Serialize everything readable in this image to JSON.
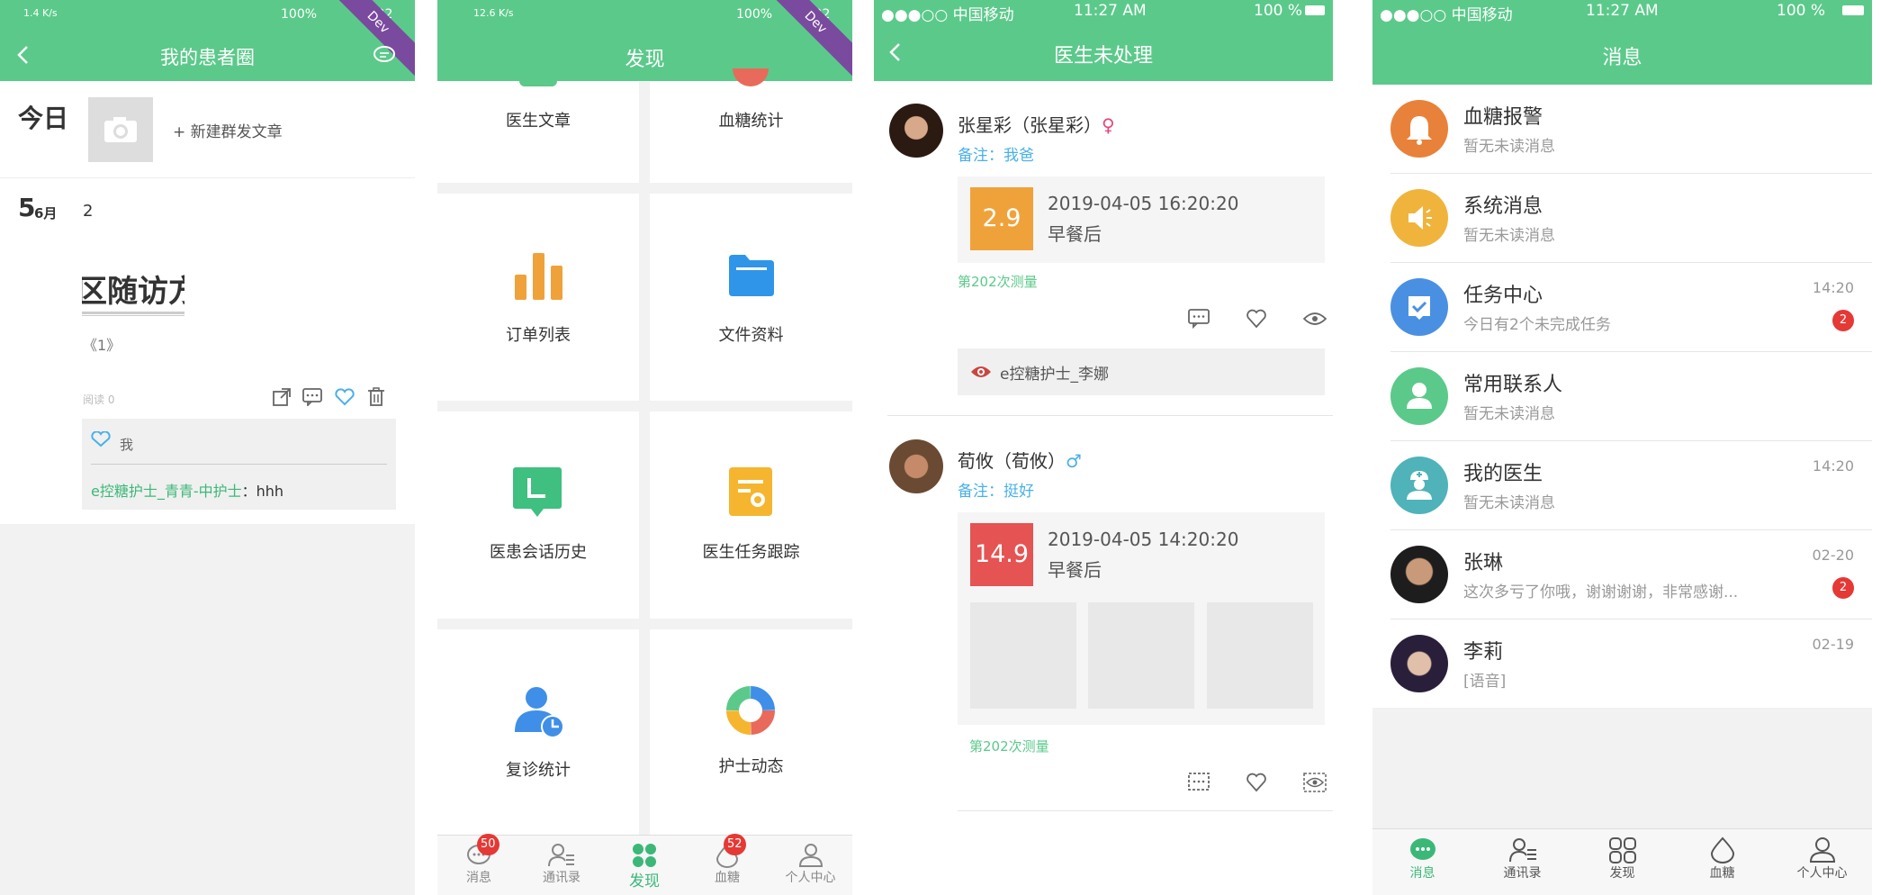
{
  "colors": {
    "primary": "#5bc98a",
    "orange": "#f0a23a",
    "red": "#e55353",
    "blue": "#4a90e2"
  },
  "p1": {
    "status_left": "1.4 K/s",
    "status_right": "100%",
    "status_time": "15:22",
    "dev": "Dev",
    "title": "我的患者圈",
    "today": "今日",
    "new_article": "+ 新建群发文章",
    "day": "5",
    "month": "6月",
    "count": "2",
    "article_text": "区随访方",
    "article_sub": "《1》",
    "reads": "阅读 0",
    "liker": "我",
    "comment_user": "e控糖护士_青青-中护士",
    "comment_sep": "：",
    "comment_text": "hhh",
    "icons": [
      "share-icon",
      "comment-icon",
      "heart-icon",
      "trash-icon"
    ]
  },
  "p2": {
    "status_left": "12.6 K/s",
    "status_right": "100%",
    "status_time": "15:22",
    "dev": "Dev",
    "title": "发现",
    "tiles": [
      {
        "label": "医生文章",
        "icon": "article-icon"
      },
      {
        "label": "血糖统计",
        "icon": "glucose-stat-icon"
      },
      {
        "label": "订单列表",
        "icon": "bar-chart-icon"
      },
      {
        "label": "文件资料",
        "icon": "folder-icon"
      },
      {
        "label": "医患会话历史",
        "icon": "chat-history-icon"
      },
      {
        "label": "医生任务跟踪",
        "icon": "task-track-icon"
      },
      {
        "label": "复诊统计",
        "icon": "revisit-icon"
      },
      {
        "label": "护士动态",
        "icon": "nurse-feed-icon"
      }
    ],
    "tabs": [
      {
        "label": "消息",
        "badge": "50"
      },
      {
        "label": "通讯录",
        "badge": ""
      },
      {
        "label": "发现",
        "badge": ""
      },
      {
        "label": "血糖",
        "badge": "52"
      },
      {
        "label": "个人中心",
        "badge": ""
      }
    ],
    "active_tab": 2
  },
  "p3": {
    "carrier": "●●●○○ 中国移动",
    "time": "11:27 AM",
    "battery": "100 %",
    "title": "医生未处理",
    "posts": [
      {
        "name": "张星彩（张星彩）",
        "gender": "♀",
        "note": "备注：我爸",
        "value": "2.9",
        "datetime": "2019-04-05 16:20:20",
        "meal": "早餐后",
        "count": "第202次测量",
        "viewer": "e控糖护士_李娜"
      },
      {
        "name": "荀攸（荀攸）",
        "gender": "♂",
        "note": "备注：挺好",
        "value": "14.9",
        "datetime": "2019-04-05 14:20:20",
        "meal": "早餐后",
        "count": "第202次测量"
      }
    ]
  },
  "p4": {
    "carrier": "●●●○○ 中国移动",
    "time": "11:27 AM",
    "battery": "100 %",
    "title": "消息",
    "rows": [
      {
        "name": "血糖报警",
        "sub": "暂无未读消息",
        "time": "",
        "badge": "",
        "icon": "bell-icon",
        "color": "#e8823a"
      },
      {
        "name": "系统消息",
        "sub": "暂无未读消息",
        "time": "",
        "badge": "",
        "icon": "speaker-icon",
        "color": "#f0b43c"
      },
      {
        "name": "任务中心",
        "sub": "今日有2个未完成任务",
        "time": "14:20",
        "badge": "2",
        "icon": "task-icon",
        "color": "#4a90e2"
      },
      {
        "name": "常用联系人",
        "sub": "暂无未读消息",
        "time": "",
        "badge": "",
        "icon": "contact-icon",
        "color": "#5bc98a"
      },
      {
        "name": "我的医生",
        "sub": "暂无未读消息",
        "time": "14:20",
        "badge": "",
        "icon": "doctor-icon",
        "color": "#4fb3b9"
      },
      {
        "name": "张琳",
        "sub": "这次多亏了你哦，谢谢谢谢，非常感谢...",
        "time": "02-20",
        "badge": "2",
        "icon": "avatar",
        "color": "#444"
      },
      {
        "name": "李莉",
        "sub": "[语音]",
        "time": "02-19",
        "badge": "",
        "icon": "avatar",
        "color": "#333"
      }
    ],
    "tabs": [
      {
        "label": "消息"
      },
      {
        "label": "通讯录"
      },
      {
        "label": "发现"
      },
      {
        "label": "血糖"
      },
      {
        "label": "个人中心"
      }
    ],
    "active_tab": 0
  }
}
